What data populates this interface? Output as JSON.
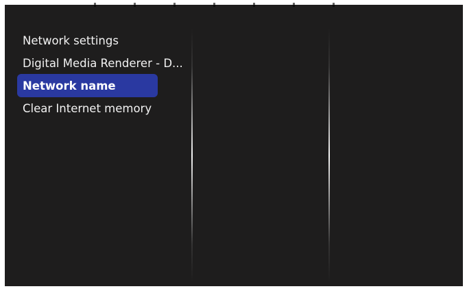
{
  "menu": {
    "items": [
      {
        "label": "Network settings"
      },
      {
        "label": "Digital Media Renderer - D..."
      },
      {
        "label": "Network name",
        "selected": true
      },
      {
        "label": "Clear Internet memory"
      }
    ]
  },
  "colors": {
    "screen_background": "#1e1d1d",
    "highlight": "#2a39a1",
    "text": "#f2f2f2"
  }
}
